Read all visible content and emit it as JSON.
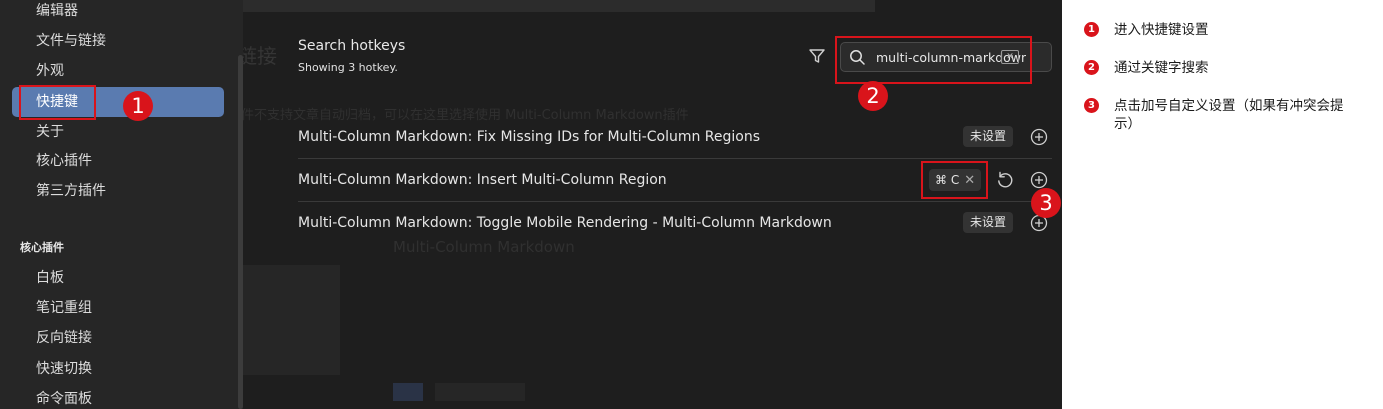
{
  "sidebar": {
    "items": [
      {
        "label": "编辑器"
      },
      {
        "label": "文件与链接"
      },
      {
        "label": "外观"
      },
      {
        "label": "快捷键"
      },
      {
        "label": "关于"
      },
      {
        "label": "核心插件"
      },
      {
        "label": "第三方插件"
      }
    ],
    "section_heading": "核心插件",
    "plugin_items": [
      {
        "label": "白板"
      },
      {
        "label": "笔记重组"
      },
      {
        "label": "反向链接"
      },
      {
        "label": "快速切换"
      },
      {
        "label": "命令面板"
      }
    ]
  },
  "background": {
    "title": "下载文章链接",
    "subtitle": "简介",
    "notice": "该插件不支持文章自动归档，可以在这里选择使用 Multi-Column Markdown插件",
    "download_heading": "下载",
    "plugin_name": "Multi-Column Markdown"
  },
  "hotkeys": {
    "title": "Search hotkeys",
    "count_text": "Showing 3 hotkey.",
    "search_value": "multi-column-markdown",
    "rows": [
      {
        "name": "Multi-Column Markdown: Fix Missing IDs for Multi-Column Regions",
        "status": "未设置"
      },
      {
        "name": "Multi-Column Markdown: Insert Multi-Column Region",
        "hotkey": "⌘ C",
        "hotkey_close": "✕"
      },
      {
        "name": "Multi-Column Markdown: Toggle Mobile Rendering - Multi-Column Markdown",
        "status": "未设置"
      }
    ]
  },
  "annotations": {
    "marker_1": "1",
    "marker_2": "2",
    "marker_3": "3",
    "accent_color": "#d9141b"
  },
  "legend": {
    "items": [
      {
        "num": "1",
        "text": "进入快捷键设置"
      },
      {
        "num": "2",
        "text": "通过关键字搜索"
      },
      {
        "num": "3",
        "text": "点击加号自定义设置（如果有冲突会提示）"
      }
    ]
  },
  "icons": {
    "filter": "filter-icon",
    "search": "search-icon",
    "clear": "clear-icon",
    "restore": "restore-icon",
    "add": "plus-circle-icon"
  },
  "colors": {
    "active_item": "#5a7bb0",
    "panel_bg": "#1e1e1e",
    "sidebar_bg": "#262626"
  }
}
